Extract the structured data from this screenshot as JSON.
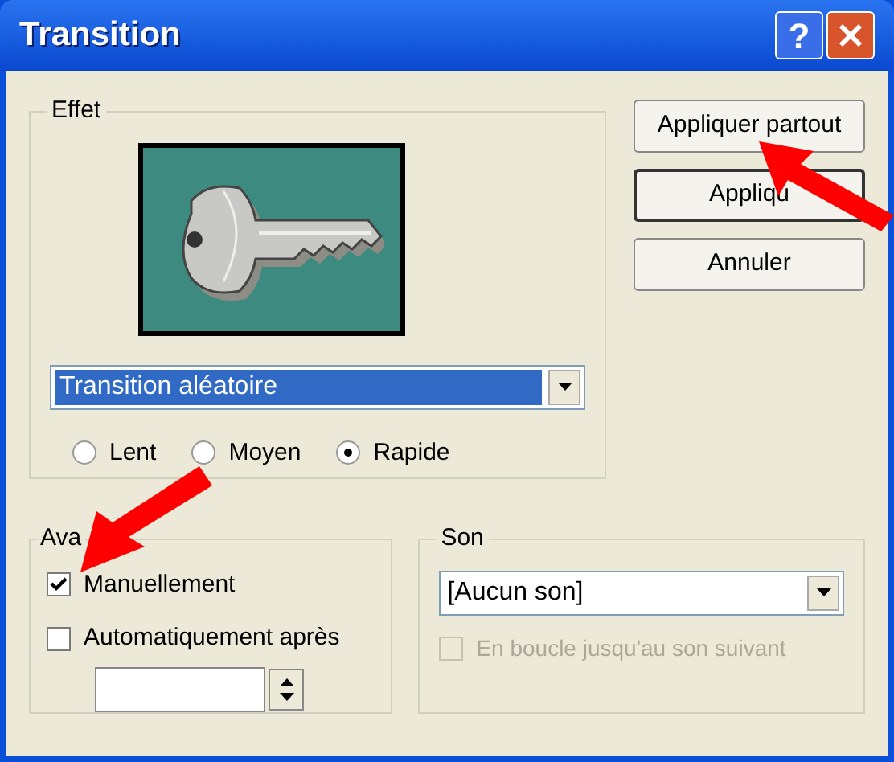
{
  "window": {
    "title": "Transition",
    "help_label": "?"
  },
  "effect": {
    "legend": "Effet",
    "selection": "Transition aléatoire",
    "speeds": [
      {
        "label": "Lent",
        "selected": false
      },
      {
        "label": "Moyen",
        "selected": false
      },
      {
        "label": "Rapide",
        "selected": true
      }
    ]
  },
  "buttons": [
    {
      "label": "Appliquer partout",
      "default": false
    },
    {
      "label": "Appliqu",
      "default": true
    },
    {
      "label": "Annuler",
      "default": false
    }
  ],
  "advance": {
    "legend": "Ava",
    "options": [
      {
        "label": "Manuellement",
        "checked": true
      },
      {
        "label": "Automatiquement après",
        "checked": false
      }
    ]
  },
  "sound": {
    "legend": "Son",
    "selection": "[Aucun son]",
    "loop": {
      "label": "En boucle jusqu'au son suivant",
      "checked": false,
      "disabled": true
    }
  }
}
